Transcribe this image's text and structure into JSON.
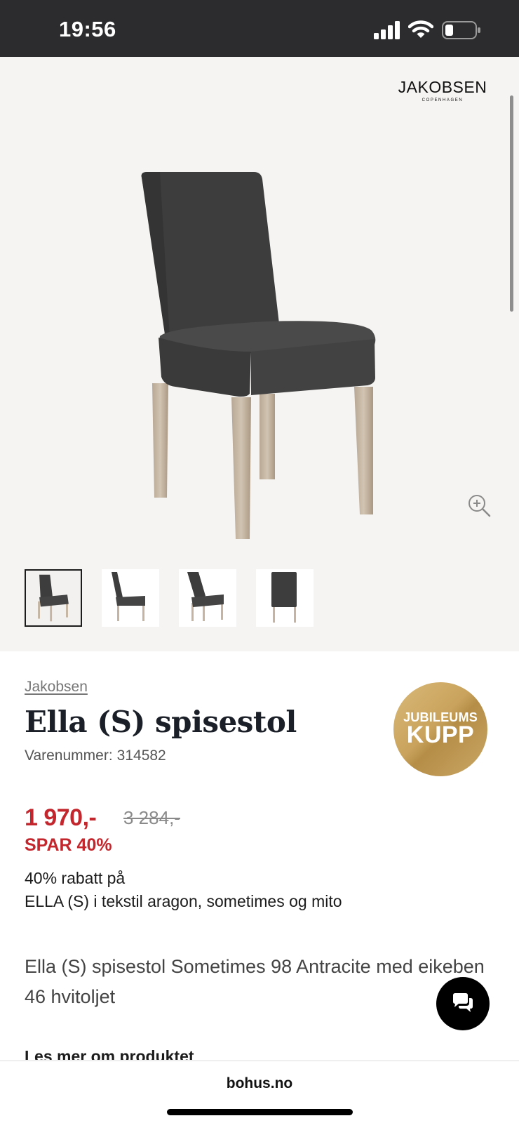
{
  "status_bar": {
    "time": "19:56"
  },
  "gallery": {
    "brand_logo": {
      "name": "JAKOBSEN",
      "sub": "COPENHAGEN"
    },
    "thumbnails": [
      "front-three-quarter",
      "side",
      "three-quarter",
      "back"
    ],
    "selected_thumbnail": 0
  },
  "product": {
    "brand": "Jakobsen",
    "title": "Ella (S) spisestol",
    "sku_label": "Varenummer:",
    "sku": "314582",
    "badge_line1": "JUBILEUMS",
    "badge_line2": "KUPP",
    "price": "1 970,-",
    "old_price": "3 284,-",
    "save": "SPAR 40%",
    "promo_line1": "40% rabatt på",
    "promo_line2": "ELLA (S) i tekstil aragon, sometimes og mito",
    "description": "Ella (S) spisestol Sometimes 98 Antracite med eikeben 46 hvitoljet",
    "read_more": "Les mer om produktet"
  },
  "browser": {
    "url": "bohus.no"
  },
  "colors": {
    "sale_red": "#c3272d",
    "badge_gold": "#c9a35d",
    "status_bar": "#2c2c2e",
    "gallery_bg": "#f6f4f2"
  }
}
